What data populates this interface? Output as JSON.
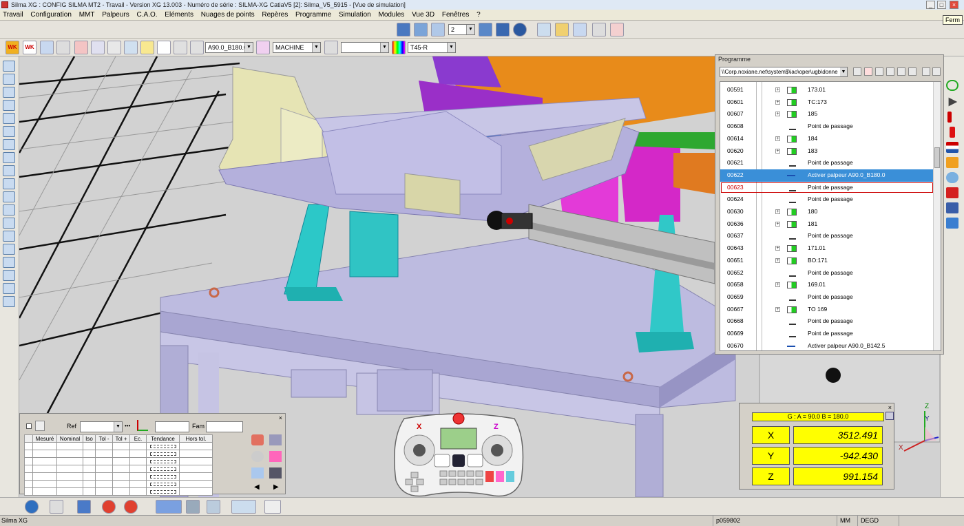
{
  "window": {
    "title": "Silma XG : CONFIG SILMA MT2 - Travail - Version XG 13.003 - Numéro de série : SILMA-XG CatiaV5 [2]: Silma_V5_5915 - [Vue de simulation]",
    "tooltip": "Ferm"
  },
  "menu": {
    "items": [
      "Travail",
      "Configuration",
      "MMT",
      "Palpeurs",
      "C.A.O.",
      "Eléments",
      "Nuages de points",
      "Repères",
      "Programme",
      "Simulation",
      "Modules",
      "Vue 3D",
      "Fenêtres",
      "?"
    ]
  },
  "toolbar": {
    "view_combo": "2",
    "probe_combo": "A90.0_B180.0",
    "machine_combo": "MACHINE",
    "empty_combo": "",
    "tool_combo": "T45-R",
    "wk_label_1": "WK",
    "wk_label_2": "WK"
  },
  "program": {
    "title": "Programme",
    "path": "\\\\Corp.noxiane.net\\system$\\iao\\oper\\ugb\\donne",
    "rows": [
      {
        "num": "00591",
        "label": "173.01",
        "type": "point"
      },
      {
        "num": "00601",
        "label": "TC:173",
        "type": "point"
      },
      {
        "num": "00607",
        "label": "185",
        "type": "point"
      },
      {
        "num": "00608",
        "label": "Point de passage",
        "type": "passage"
      },
      {
        "num": "00614",
        "label": "184",
        "type": "point"
      },
      {
        "num": "00620",
        "label": "183",
        "type": "point"
      },
      {
        "num": "00621",
        "label": "Point de passage",
        "type": "passage"
      },
      {
        "num": "00622",
        "label": "Activer palpeur A90.0_B180.0",
        "type": "probe",
        "selected": true
      },
      {
        "num": "00623",
        "label": "Point de passage",
        "type": "passage",
        "current": true
      },
      {
        "num": "00624",
        "label": "Point de passage",
        "type": "passage"
      },
      {
        "num": "00630",
        "label": "180",
        "type": "point"
      },
      {
        "num": "00636",
        "label": "181",
        "type": "point"
      },
      {
        "num": "00637",
        "label": "Point de passage",
        "type": "passage"
      },
      {
        "num": "00643",
        "label": "171.01",
        "type": "point"
      },
      {
        "num": "00651",
        "label": "BO:171",
        "type": "point"
      },
      {
        "num": "00652",
        "label": "Point de passage",
        "type": "passage"
      },
      {
        "num": "00658",
        "label": "169.01",
        "type": "point"
      },
      {
        "num": "00659",
        "label": "Point de passage",
        "type": "passage"
      },
      {
        "num": "00667",
        "label": "TO 169",
        "type": "point"
      },
      {
        "num": "00668",
        "label": "Point de passage",
        "type": "passage"
      },
      {
        "num": "00669",
        "label": "Point de passage",
        "type": "passage"
      },
      {
        "num": "00670",
        "label": "Activer palpeur A90.0_B142.5",
        "type": "probe"
      }
    ]
  },
  "measurement": {
    "ref_label": "Ref",
    "fam_label": "Fam",
    "dots": "•••",
    "columns": [
      "",
      "Mesuré",
      "Nominal",
      "Iso",
      "Tol -",
      "Tol +",
      "Ec.",
      "Tendance",
      "Hors tol."
    ],
    "row_count": 7
  },
  "pendant": {
    "x_label": "X",
    "z_label": "Z"
  },
  "coords": {
    "header": "G : A = 90.0 B = 180.0",
    "x_label": "X",
    "x_value": "3512.491",
    "y_label": "Y",
    "y_value": "-942.430",
    "z_label": "Z",
    "z_value": "991.154"
  },
  "axes": {
    "x": "X",
    "y": "Y",
    "z": "Z"
  },
  "status": {
    "app": "Silma XG",
    "user": "p059802",
    "units": "MM",
    "angle_units": "DEGD"
  },
  "colors": {
    "selection": "#3a8fd8",
    "yellow": "#ffff00",
    "accent_red": "#cc0000"
  }
}
